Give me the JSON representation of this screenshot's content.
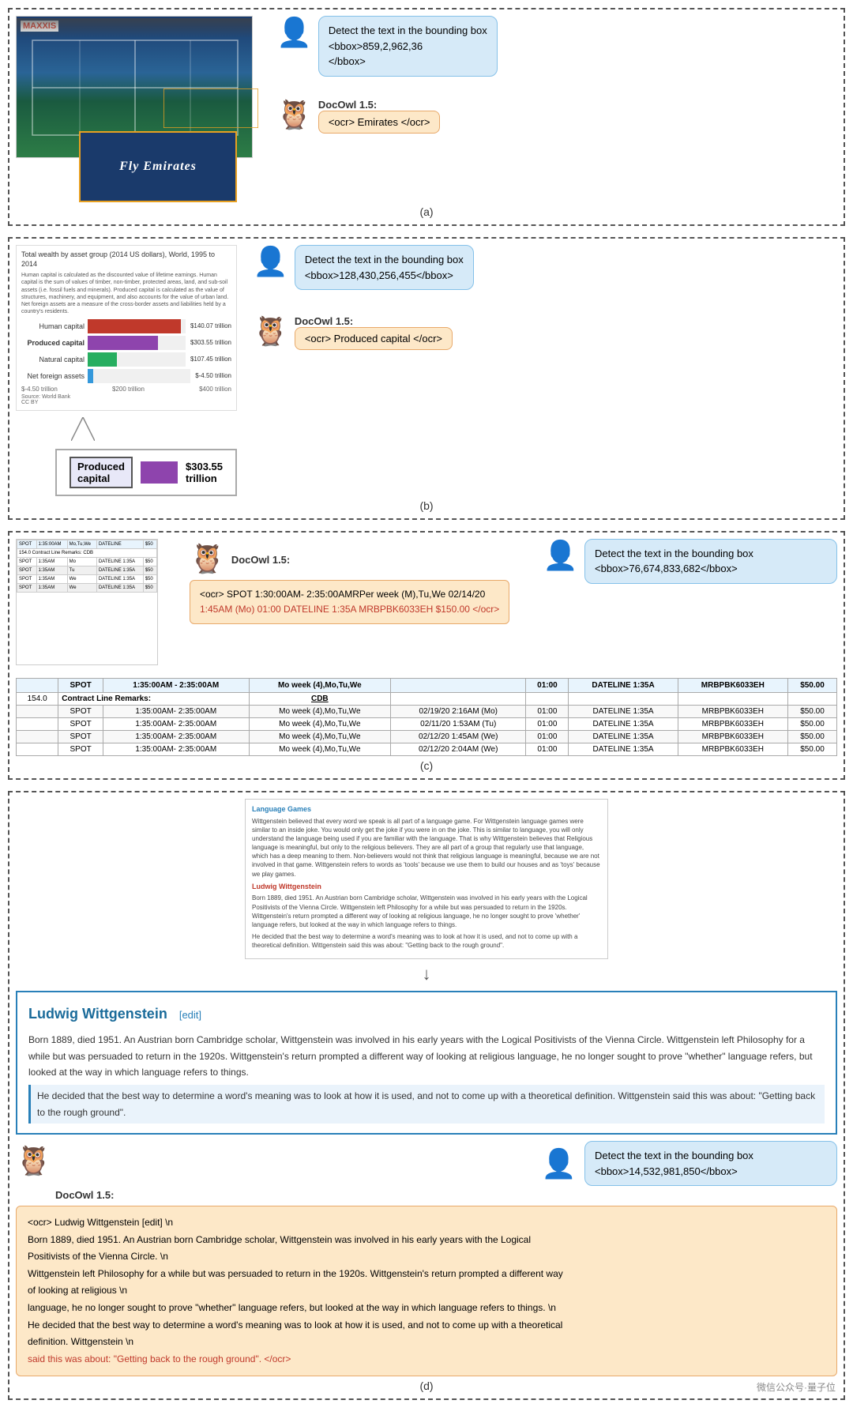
{
  "sections": {
    "a": {
      "label": "(a)",
      "user_prompt": "Detect the text in the bounding box\n<bbox>859,2,962,36\n</bbox>",
      "docowl_label": "DocOwl 1.5:",
      "ocr_result": "<ocr> Emirates </ocr>",
      "emirates_text": "Fly Emirates",
      "maxxis_text": "MAXXIS"
    },
    "b": {
      "label": "(b)",
      "user_prompt": "Detect the text in the bounding box\n<bbox>128,430,256,455</bbox>",
      "docowl_label": "DocOwl 1.5:",
      "ocr_result": "<ocr> Produced capital </ocr>",
      "chart_title": "Total wealth by asset group (2014 US dollars), World, 1995 to 2014",
      "chart_subtitle": "Human capital is calculated as the discounted value of lifetime earnings. Human capital is the sum of values of timber, non-timber, protected areas, land, and sub-soil assets (i.e. fossil fuels and minerals). Produced capital is calculated as the value of structures, machinery, and equipment, and also accounts for the value of urban land. Net foreign assets are a measure of the cross-border assets and liabilities held by a country's residents.",
      "bars": [
        {
          "label": "Human capital",
          "color": "#e74c3c",
          "width_pct": 95,
          "value": "$140.07 trillion"
        },
        {
          "label": "Produced capital",
          "color": "#8e44ad",
          "width_pct": 72,
          "value": "$303.55 trillion"
        },
        {
          "label": "Natural capital",
          "color": "#27ae60",
          "width_pct": 30,
          "value": "$107.45 trillion"
        },
        {
          "label": "Net foreign assets",
          "color": "#3498db",
          "width_pct": 5,
          "value": "$-4.50 trillion"
        }
      ],
      "zoom_label": "Produced capital",
      "zoom_value": "$303.55 trillion",
      "source": "Source: World Bank",
      "license": "CC BY"
    },
    "c": {
      "label": "(c)",
      "user_prompt": "Detect the text in the bounding box <bbox>76,674,833,682</bbox>",
      "docowl_label": "DocOwl 1.5:",
      "ocr_result": "<ocr> SPOT 1:30:00AM- 2:35:00AMRPer week (M),Tu,We 02/14/20",
      "ocr_result2": "1:45AM (Mo) 01:00 DATELINE 1:35A MRBPBK6033EH $150.00 </ocr>",
      "table_headers": [
        "",
        "SPOT",
        "1:35:00AM - 2:35:00AM",
        "Mo week (4),Mo,Tu,We",
        "",
        "01:00",
        "DATELINE 1:35A",
        "MRBPBK6033EH",
        "$50.00"
      ],
      "table_rows": [
        [
          "154.0",
          "Contract Line Remarks:",
          "CDB",
          "",
          "",
          "",
          "",
          "",
          ""
        ],
        [
          "",
          "SPOT",
          "1:35:00AM- 2:35:00AM",
          "Mo week (4),Mo,Tu,We",
          "02/19/20 2:16AM (Mo)",
          "01:00",
          "DATELINE 1:35A",
          "MRBPBK6033EH",
          "$50.00"
        ],
        [
          "",
          "SPOT",
          "1:35:00AM- 2:35:00AM",
          "Mo week (4),Mo,Tu,We",
          "02/11/20 1:53AM (Tu)",
          "01:00",
          "DATELINE 1:35A",
          "MRBPBK6033EH",
          "$50.00"
        ],
        [
          "",
          "SPOT",
          "1:35:00AM- 2:35:00AM",
          "Mo week (4),Mo,Tu,We",
          "02/12/20 1:45AM (We)",
          "01:00",
          "DATELINE 1:35A",
          "MRBPBK6033EH",
          "$50.00"
        ],
        [
          "",
          "SPOT",
          "1:35:00AM- 2:35:00AM",
          "Mo week (4),Mo,Tu,We",
          "02/12/20 2:04AM (We)",
          "01:00",
          "DATELINE 1:35A",
          "MRBPBK6033EH",
          "$50.00"
        ]
      ]
    },
    "d": {
      "label": "(d)",
      "user_prompt": "Detect the text in the bounding box <bbox>14,532,981,850</bbox>",
      "docowl_label": "DocOwl 1.5:",
      "wiki_mini_title1": "Language Games",
      "wiki_mini_body1": "Wittgenstein believed that every word we speak is all part of a language game. For Wittgenstein language games were similar to an inside joke. You would only get the joke if you were in on the joke. This is similar to language, you will only understand the language being used if you are familiar with the language. That is why Wittgenstein believes that Religious language is meaningful, but only to the religious believers. They are all part of a group that regularly use that language, which has a deep meaning to them. Non-believers would not think that religious language is meaningful, because we are not involved in that game. Wittgenstein refers to words as 'tools' because we use them to build our houses and as 'toys' because we play games.",
      "wiki_mini_title2": "Ludwig Wittgenstein",
      "wiki_mini_body2": "Born 1889, died 1951. An Austrian born Cambridge scholar, Wittgenstein was involved in his early years with the Logical Positivists of the Vienna Circle. Wittgenstein left Philosophy for a while but was persuaded to return in the 1920s. Wittgenstein's return prompted a different way of looking at religious language, he no longer sought to prove 'whether' language refers, but looked at the way in which language refers to things.",
      "wiki_mini_body3": "He decided that the best way to determine a word's meaning was to look at how it is used, and not to come up with a theoretical definition. Wittgenstein said this was about: \"Getting back to the rough ground\".",
      "wiki_full_title": "Ludwig Wittgenstein",
      "wiki_full_edit": "[edit]",
      "wiki_full_body1": "Born 1889, died 1951. An Austrian born Cambridge scholar, Wittgenstein was involved in his early years with the Logical Positivists of the Vienna Circle. Wittgenstein left Philosophy for a while but was persuaded to return in the 1920s. Wittgenstein's return prompted a different way of looking at religious language, he no longer sought to prove \"whether\" language refers, but looked at the way in which language refers to things.",
      "wiki_full_highlight": "He decided that the best way to determine a word's meaning was to look at how it is used, and not to come up with a theoretical definition. Wittgenstein said this was about: \"Getting back to the rough ground\".",
      "ocr_full": "<ocr> Ludwig   Wittgenstein   [edit] \\n\nBorn 1889, died 1951. An Austrian born Cambridge scholar, Wittgenstein was involved in his early years with the Logical\nPositivists of the Vienna Circle. \\n\nWittgenstein left Philosophy for a while but was persuaded to return in the 1920s. Wittgenstein's return prompted a different way\nof looking at religious \\n\nlanguage, he no longer sought to prove \"whether\" language refers, but looked at the way in which language refers to things. \\n\nHe decided that the best way to determine a word's meaning was to look at how it is used, and not to come up with a theoretical\ndefinition. Wittgenstein \\n",
      "ocr_red": "said this was about: \"Getting back to the rough ground\". </ocr>",
      "wechat": "微信公众号·量子位"
    }
  }
}
